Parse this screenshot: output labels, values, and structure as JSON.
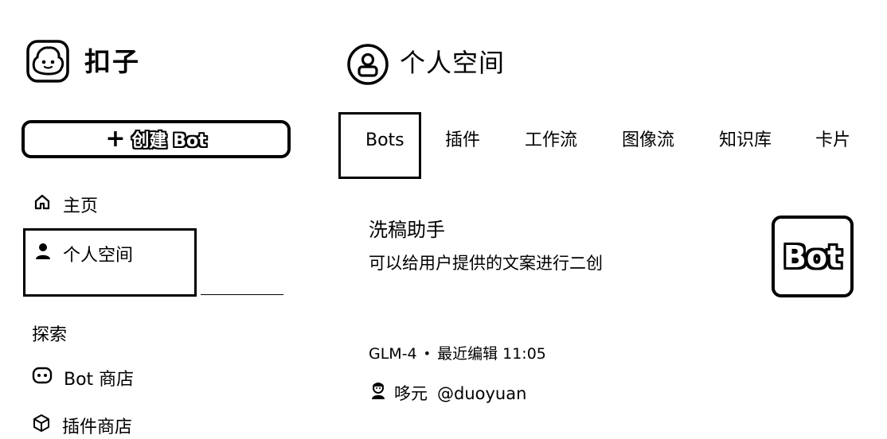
{
  "brand": {
    "name": "扣子",
    "icon": "coze-logo-icon"
  },
  "sidebar": {
    "create_button": {
      "icon": "plus-icon",
      "label": "创建 Bot"
    },
    "items": [
      {
        "label": "主页",
        "icon": "home-icon"
      },
      {
        "label": "个人空间",
        "icon": "person-icon"
      }
    ],
    "section_explore": "探索",
    "explore_items": [
      {
        "label": "Bot 商店",
        "icon": "bot-face-icon"
      },
      {
        "label": "插件商店",
        "icon": "cube-icon"
      }
    ]
  },
  "header": {
    "title": "个人空间",
    "icon": "user-circle-icon"
  },
  "tabs": [
    {
      "label": "Bots",
      "active": true
    },
    {
      "label": "插件",
      "active": false
    },
    {
      "label": "工作流",
      "active": false
    },
    {
      "label": "图像流",
      "active": false
    },
    {
      "label": "知识库",
      "active": false
    },
    {
      "label": "卡片",
      "active": false
    }
  ],
  "bot_card": {
    "title": "洗稿助手",
    "description": "可以给用户提供的文案进行二创",
    "avatar_text": "Bot",
    "model": "GLM-4",
    "edited": "最近编辑 11:05",
    "author_name": "哆元",
    "author_handle": "@duoyuan",
    "author_icon": "author-avatar-icon"
  }
}
